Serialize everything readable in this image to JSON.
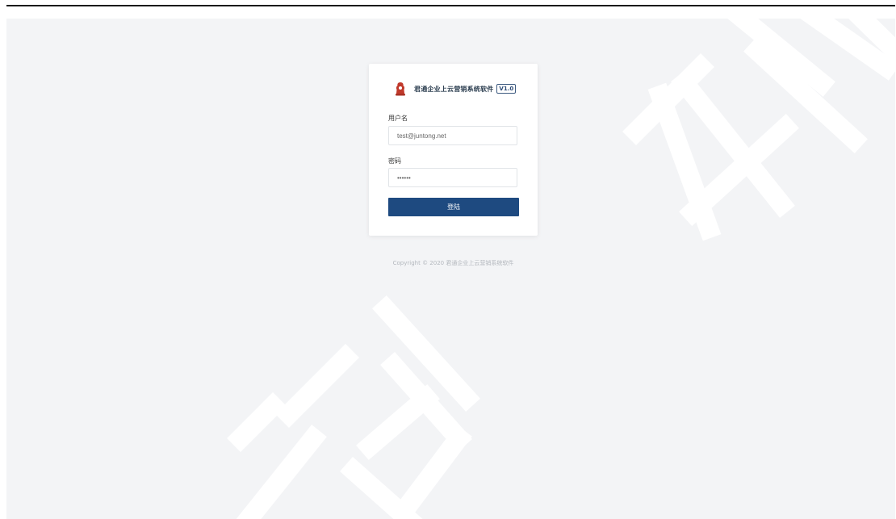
{
  "brand": {
    "name": "君通企业上云营销系统软件",
    "version": "V1.0",
    "logo_icon": "chess-piece-logo-icon",
    "accent_color": "#1e4a80",
    "logo_color": "#c0392b"
  },
  "form": {
    "username_label": "用户名",
    "username_value": "test@juntong.net",
    "password_label": "密码",
    "password_value": "••••••",
    "login_label": "登陆"
  },
  "footer": {
    "copyright": "Copyright © 2020 君通企业上云营销系统软件"
  },
  "watermark": {
    "char_top": "无",
    "char_bottom": "君通",
    "color": "#ffffff"
  }
}
